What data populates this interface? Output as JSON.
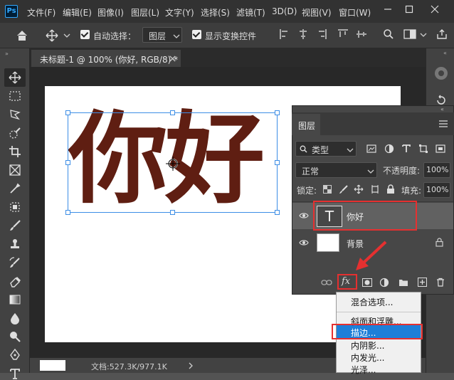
{
  "menubar": {
    "logo": "Ps",
    "items": [
      "文件(F)",
      "编辑(E)",
      "图像(I)",
      "图层(L)",
      "文字(Y)",
      "选择(S)",
      "滤镜(T)",
      "3D(D)",
      "视图(V)",
      "窗口(W)"
    ]
  },
  "options": {
    "auto_select_label": "自动选择：",
    "auto_select_value": "图层",
    "show_transform_label": "显示变换控件"
  },
  "document": {
    "tab_title": "未标题-1 @ 100% (你好, RGB/8) *",
    "canvas_text": "你好",
    "status": "文档:527.3K/977.1K"
  },
  "layers_panel": {
    "tab": "图层",
    "filter_kind": "类型",
    "blend_mode": "正常",
    "opacity_label": "不透明度:",
    "opacity_value": "100%",
    "lock_label": "锁定:",
    "fill_label": "填充:",
    "fill_value": "100%",
    "layers": [
      {
        "name": "你好",
        "type": "text",
        "thumb_glyph": "T"
      },
      {
        "name": "背景",
        "type": "image"
      }
    ],
    "fx_label": "fx"
  },
  "context_menu": {
    "items": [
      "混合选项...",
      "斜面和浮雕...",
      "描边...",
      "内阴影...",
      "内发光...",
      "光泽..."
    ],
    "selected": "描边..."
  },
  "colors": {
    "text_color": "#5f1e12",
    "highlight": "#1e7fd8",
    "annotation_red": "#e53030",
    "selection_blue": "#3d8ee6"
  }
}
